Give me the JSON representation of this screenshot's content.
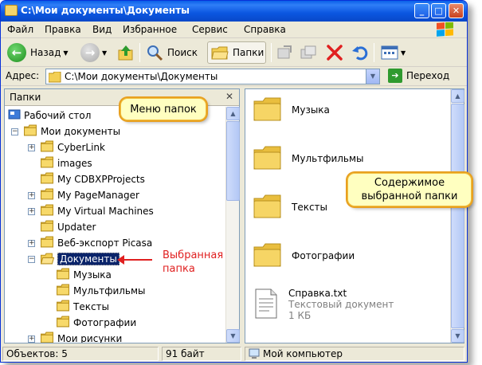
{
  "window": {
    "title": "C:\\Мои документы\\Документы"
  },
  "menu": [
    "Файл",
    "Правка",
    "Вид",
    "Избранное",
    "Сервис",
    "Справка"
  ],
  "toolbar": {
    "back": "Назад",
    "search": "Поиск",
    "folders": "Папки"
  },
  "address": {
    "label": "Адрес:",
    "path": "C:\\Мои документы\\Документы",
    "go": "Переход"
  },
  "folder_pane": {
    "header": "Папки",
    "tree": [
      {
        "label": "Рабочий стол",
        "level": 0,
        "expander": "none",
        "icon": "desktop-icon"
      },
      {
        "label": "Мои документы",
        "level": 1,
        "expander": "minus",
        "icon": "folder-icon"
      },
      {
        "label": "CyberLink",
        "level": 2,
        "expander": "plus",
        "icon": "folder-icon"
      },
      {
        "label": "images",
        "level": 2,
        "expander": "none",
        "icon": "folder-icon"
      },
      {
        "label": "My CDBXPProjects",
        "level": 2,
        "expander": "none",
        "icon": "folder-icon"
      },
      {
        "label": "My PageManager",
        "level": 2,
        "expander": "plus",
        "icon": "folder-icon"
      },
      {
        "label": "My Virtual Machines",
        "level": 2,
        "expander": "plus",
        "icon": "folder-icon"
      },
      {
        "label": "Updater",
        "level": 2,
        "expander": "none",
        "icon": "folder-icon"
      },
      {
        "label": "Веб-экспорт Picasa",
        "level": 2,
        "expander": "plus",
        "icon": "folder-icon"
      },
      {
        "label": "Документы",
        "level": 2,
        "expander": "minus",
        "icon": "open-folder-icon",
        "selected": true
      },
      {
        "label": "Музыка",
        "level": 3,
        "expander": "none",
        "icon": "folder-icon"
      },
      {
        "label": "Мультфильмы",
        "level": 3,
        "expander": "none",
        "icon": "folder-icon"
      },
      {
        "label": "Тексты",
        "level": 3,
        "expander": "none",
        "icon": "folder-icon"
      },
      {
        "label": "Фотографии",
        "level": 3,
        "expander": "none",
        "icon": "folder-icon"
      },
      {
        "label": "Мои рисунки",
        "level": 2,
        "expander": "plus",
        "icon": "folder-icon"
      }
    ]
  },
  "content_pane": {
    "items": [
      {
        "label": "Музыка",
        "icon": "folder-icon"
      },
      {
        "label": "Мультфильмы",
        "icon": "folder-icon"
      },
      {
        "label": "Тексты",
        "icon": "folder-icon"
      },
      {
        "label": "Фотографии",
        "icon": "folder-icon"
      },
      {
        "label": "Справка.txt",
        "type": "Текстовый документ",
        "size": "1 КБ",
        "icon": "text-file-icon"
      }
    ]
  },
  "status": {
    "objects": "Объектов: 5",
    "size": "91 байт",
    "location": "Мой компьютер"
  },
  "callouts": {
    "folder_menu": "Меню папок",
    "content": "Содержимое выбранной папки",
    "selected_folder": "Выбранная папка"
  },
  "colors": {
    "title_bar": "#0a5fe8",
    "selection": "#0a246a",
    "callout_bg": "#ffffc0",
    "annotation": "#e02020"
  }
}
